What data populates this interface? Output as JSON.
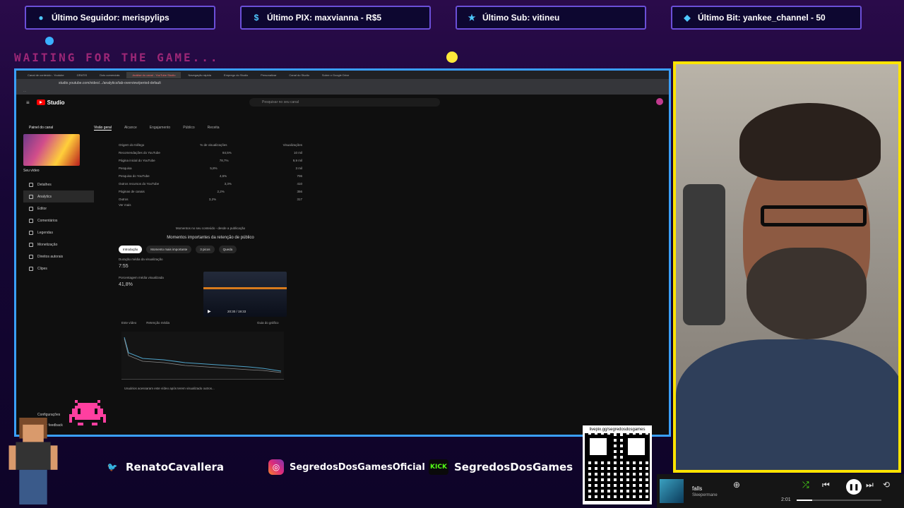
{
  "alerts": [
    {
      "icon": "person-icon",
      "label": "Último Seguidor: merispylips"
    },
    {
      "icon": "dollar-icon",
      "label": "Último PIX: maxvianna - R$5"
    },
    {
      "icon": "star-icon",
      "label": "Último Sub: vitineu"
    },
    {
      "icon": "diamond-icon",
      "label": "Último Bit: yankee_channel - 50"
    }
  ],
  "waiting_text": "WAITING FOR THE GAME...",
  "browser": {
    "tabs": [
      "Canal de conteúdo - Youtube",
      "GRATIS",
      "Dois comerciais",
      "Análise do canal - YouTube Studio",
      "Navegação rápida",
      "Emprego do Studio",
      "Personalizar",
      "Canal do Studio",
      "Sobre o Google Drive"
    ],
    "active_tab_index": 3,
    "url": "studio.youtube.com/video/.../analytics/tab-overview/period-default"
  },
  "youtube": {
    "logo": "Studio",
    "search_placeholder": "Pesquisar no seu canal",
    "channel_section": "Painel do canal",
    "channel_name": "Seu vídeo",
    "subtabs": [
      "Visão geral",
      "Alcance",
      "Engajamento",
      "Público",
      "Receita"
    ],
    "sidebar": [
      "Detalhes",
      "Analytics",
      "Editor",
      "Comentários",
      "Legendas",
      "Monetização",
      "Direitos autorais",
      "Clipes"
    ],
    "sidebar_bottom": [
      "Configurações",
      "Enviar feedback"
    ],
    "traffic_header": [
      "Origem do tráfego",
      "% de visualizações",
      "Visualizações"
    ],
    "traffic_rows": [
      {
        "label": "Recomendações do YouTube",
        "pct": "84,5%",
        "views": "10 mil"
      },
      {
        "label": "Página inicial do YouTube",
        "pct": "78,7%",
        "views": "9,9 mil"
      },
      {
        "label": "Pesquisa",
        "pct": "5,8%",
        "views": "3 mil"
      },
      {
        "label": "Pesquisa do YouTube",
        "pct": "4,6%",
        "views": "706"
      },
      {
        "label": "Outros recursos do YouTube",
        "pct": "3,3%",
        "views": "410"
      },
      {
        "label": "Páginas de canais",
        "pct": "2,2%",
        "views": "356"
      },
      {
        "label": "Outros",
        "pct": "3,2%",
        "views": "317"
      }
    ],
    "see_more": "Ver mais",
    "retention_caption": "Momentos no seu conteúdo - desde a publicação",
    "retention_title": "Momentos importantes da retenção de público",
    "chips": [
      "Introdução",
      "Momento mais importante",
      "3 picos",
      "Queda"
    ],
    "avg_duration_label": "Duração média da visualização",
    "avg_duration_value": "7:55",
    "avg_pct_label": "Porcentagem média visualizada",
    "avg_pct_value": "41,8%",
    "video_time": "20:30 / 19:33",
    "legend": [
      "Este vídeo",
      "Retenção média"
    ],
    "chart_link": "Guia do gráfico",
    "footnote": "Usuários acessaram este vídeo após terem visualizado outros..."
  },
  "socials": [
    {
      "icon": "twitter-icon",
      "label": "RenatoCavallera"
    },
    {
      "icon": "instagram-icon",
      "label": "SegredosDosGamesOficial"
    },
    {
      "icon": "kick-icon",
      "label": "SegredosDosGames"
    }
  ],
  "qr": {
    "url": "livepix.gg/segredosdosgames"
  },
  "player": {
    "title": "falls",
    "artist": "Sleepermane",
    "time": "2:01",
    "progress": 0.18
  }
}
